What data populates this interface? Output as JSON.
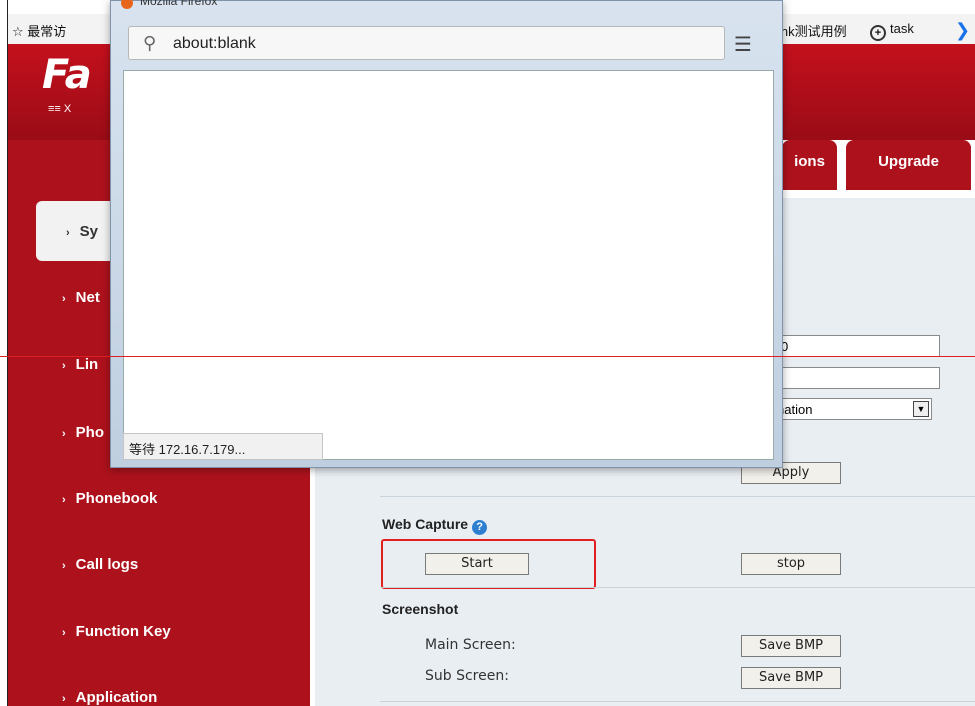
{
  "bookmarks": {
    "left_label": "☆ 最常访",
    "items": [
      {
        "label": "ink测试用例"
      },
      {
        "label": "task"
      }
    ]
  },
  "header": {
    "logo": "Fa",
    "logo_sub": "X"
  },
  "tabs": {
    "partial": "ions",
    "upgrade": "Upgrade"
  },
  "sidebar": {
    "items": [
      {
        "label": "Sy"
      },
      {
        "label": "Net"
      },
      {
        "label": "Lin"
      },
      {
        "label": "Pho"
      },
      {
        "label": "Phonebook"
      },
      {
        "label": "Call logs"
      },
      {
        "label": "Function Key"
      },
      {
        "label": "Application"
      }
    ]
  },
  "form": {
    "input1_value": "0",
    "input2_value": "",
    "select_value": "nation",
    "apply_label": "Apply"
  },
  "web_capture": {
    "title": "Web Capture",
    "start_label": "Start",
    "stop_label": "stop"
  },
  "screenshot": {
    "title": "Screenshot",
    "main_label": "Main Screen:",
    "sub_label": "Sub Screen:",
    "save_label": "Save BMP"
  },
  "popup": {
    "title": "Mozilla Firefox",
    "url": "about:blank",
    "status": "等待 172.16.7.179..."
  }
}
